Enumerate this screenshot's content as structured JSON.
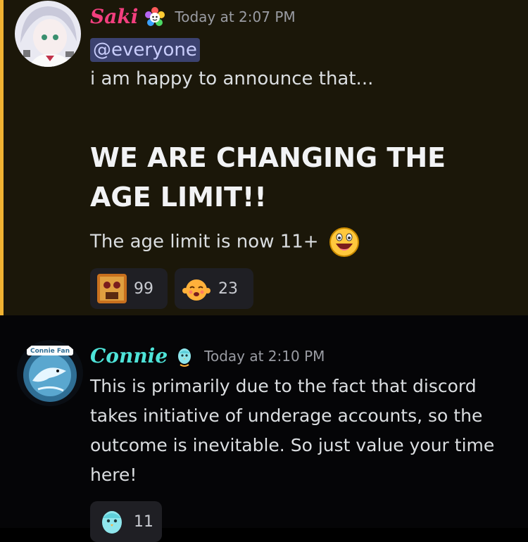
{
  "messages": [
    {
      "username": "Saki",
      "username_color": "#f23f7e",
      "timestamp": "Today at 2:07 PM",
      "mention": "@everyone",
      "line1": "i am happy to announce that...",
      "headline": "WE ARE CHANGING THE AGE LIMIT!!",
      "line2": "The age limit is now 11+",
      "reactions": [
        {
          "icon": "crowd-sticker-emoji",
          "count": "99"
        },
        {
          "icon": "blushing-emoji",
          "count": "23"
        }
      ]
    },
    {
      "username": "Connie",
      "username_color": "#4ee3d8",
      "timestamp": "Today at 2:10 PM",
      "avatar_text": "Connie Fan",
      "body": "This is primarily due to the fact that discord takes initiative of underage accounts, so the outcome is inevitable. So just value your time here!",
      "reactions": [
        {
          "icon": "cyan-bird-emoji",
          "count": "11"
        }
      ]
    }
  ],
  "colors": {
    "mention_highlight_bar": "#f0b232",
    "mention_background": "#1b1709",
    "mention_pill": "#3c4270"
  }
}
